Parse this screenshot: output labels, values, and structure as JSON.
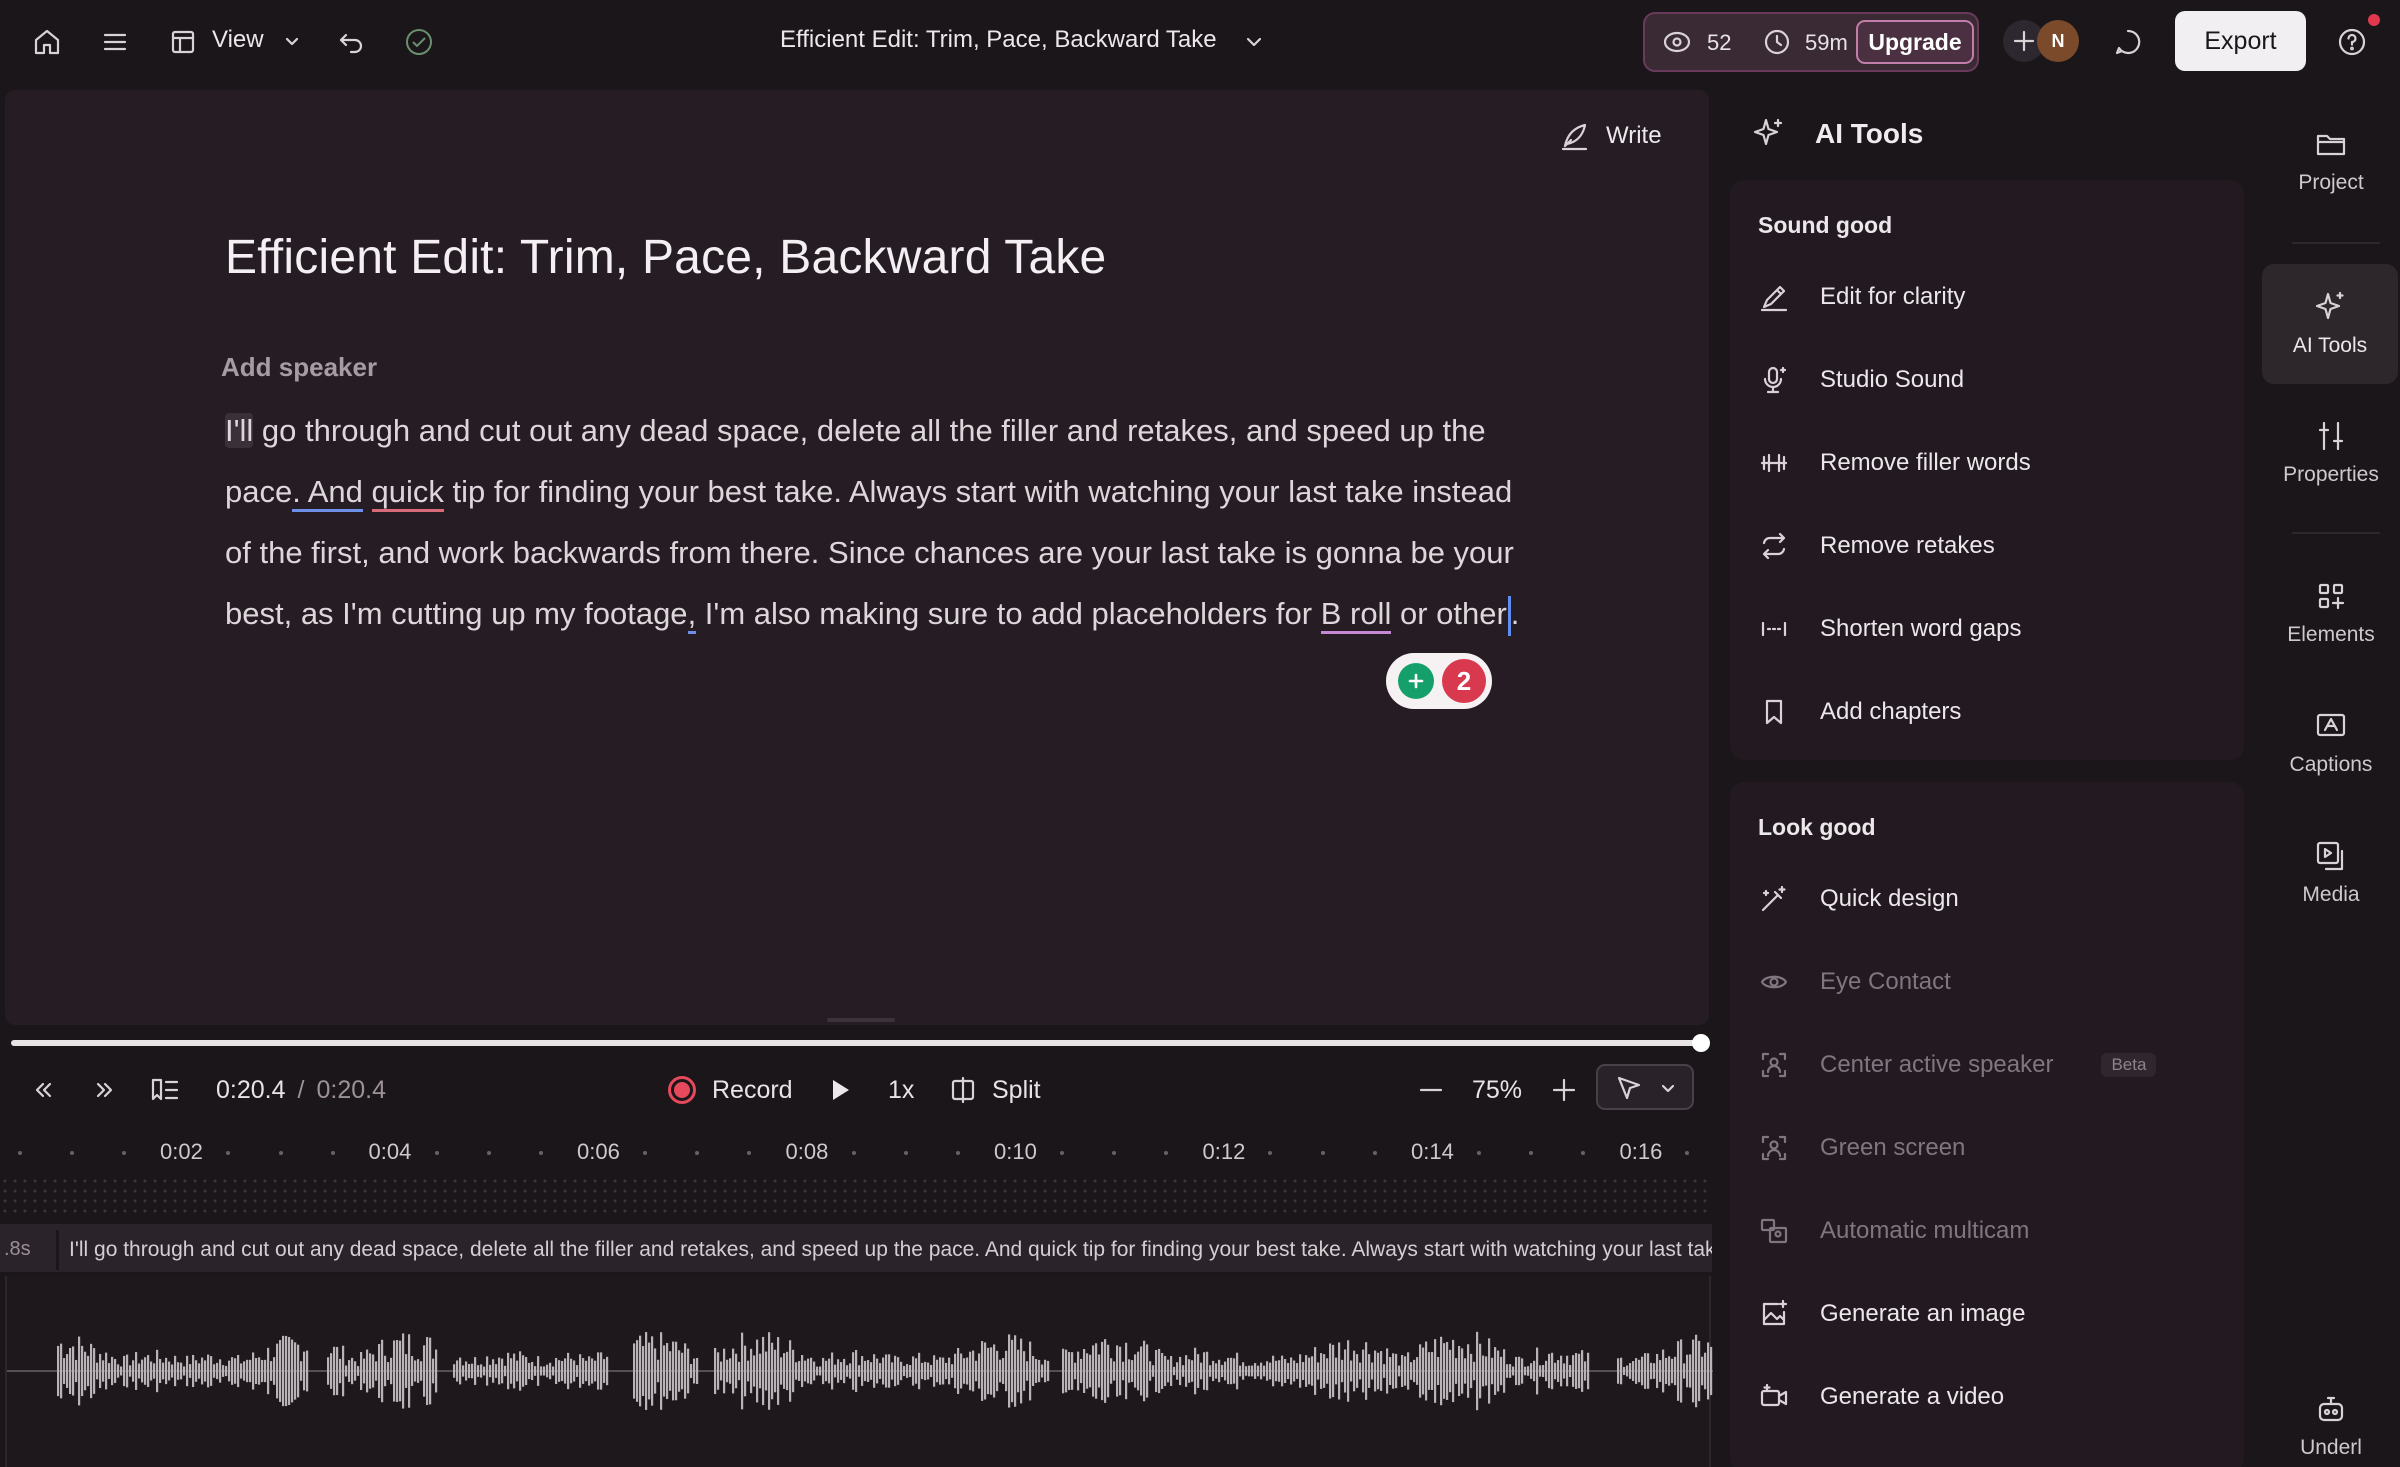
{
  "topbar": {
    "view_label": "View",
    "document_title": "Efficient Edit: Trim, Pace, Backward Take",
    "credits_count": "52",
    "time_remaining": "59m",
    "upgrade_label": "Upgrade",
    "avatar_initial": "N",
    "export_label": "Export"
  },
  "editor": {
    "write_label": "Write",
    "title": "Efficient Edit: Trim, Pace, Backward Take",
    "add_speaker": "Add speaker",
    "transcript": {
      "p1": "I'll",
      "p2": " go through and cut out any dead space, delete all the filler and retakes, and speed up the pace",
      "p3": ". And",
      "p4": " ",
      "p5": "quick",
      "p6": " tip for finding your best take. Always start with watching your last take instead of the first, and work backwards from there. Since chances are your last take is gonna be your best, as I'm cutting up my footage",
      "p7": ",",
      "p8": " I'm also making sure to add placeholders for ",
      "p9": "B roll",
      "p10": " or other",
      "p11": "."
    },
    "grammar_count": "2"
  },
  "player": {
    "current_time": "0:20.4",
    "separator": "/",
    "total_time": "0:20.4",
    "record_label": "Record",
    "speed": "1x",
    "split_label": "Split",
    "zoom": "75%",
    "progress": 1.0
  },
  "timeline": {
    "ticks": [
      "0:02",
      "0:04",
      "0:06",
      "0:08",
      "0:10",
      "0:12",
      "0:14",
      "0:16"
    ],
    "clip_prefix": ".8s",
    "clip_text": "I'll go through and cut out any dead space, delete all the filler and retakes, and speed up the pace. And quick tip for finding your best take. Always start with watching your last take instead of the first"
  },
  "ai_tools": {
    "header": "AI Tools",
    "sound_good": {
      "title": "Sound good",
      "items": [
        "Edit for clarity",
        "Studio Sound",
        "Remove filler words",
        "Remove retakes",
        "Shorten word gaps",
        "Add chapters"
      ]
    },
    "look_good": {
      "title": "Look good",
      "items": [
        "Quick design",
        "Eye Contact",
        "Center active speaker",
        "Green screen",
        "Automatic multicam",
        "Generate an image",
        "Generate a video"
      ],
      "beta_label": "Beta"
    }
  },
  "rail": {
    "items": [
      "Project",
      "AI Tools",
      "Properties",
      "Elements",
      "Captions",
      "Media",
      "Underl"
    ]
  },
  "colors": {
    "background": "#1a1619",
    "editor_bg": "#251d23",
    "accent_record": "#e6485c",
    "upgrade_border": "#c27ea8",
    "grammar_green": "#15a06b"
  }
}
